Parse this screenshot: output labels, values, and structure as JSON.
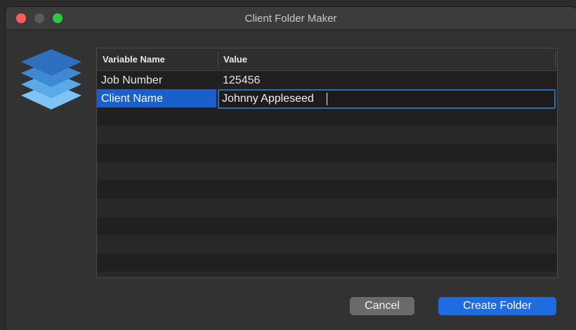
{
  "window": {
    "title": "Client Folder Maker"
  },
  "colors": {
    "accent": "#1f6ce0",
    "selection": "#1a5fcc",
    "close": "#fc5f57",
    "maximize": "#2acb42"
  },
  "icons": {
    "app": "stacked-layers-icon"
  },
  "table": {
    "columns": [
      "Variable Name",
      "Value"
    ],
    "rows": [
      {
        "name": "Job Number",
        "value": "125456"
      },
      {
        "name": "Client Name",
        "value": "Johnny Appleseed"
      }
    ]
  },
  "buttons": {
    "cancel": "Cancel",
    "create": "Create Folder"
  }
}
